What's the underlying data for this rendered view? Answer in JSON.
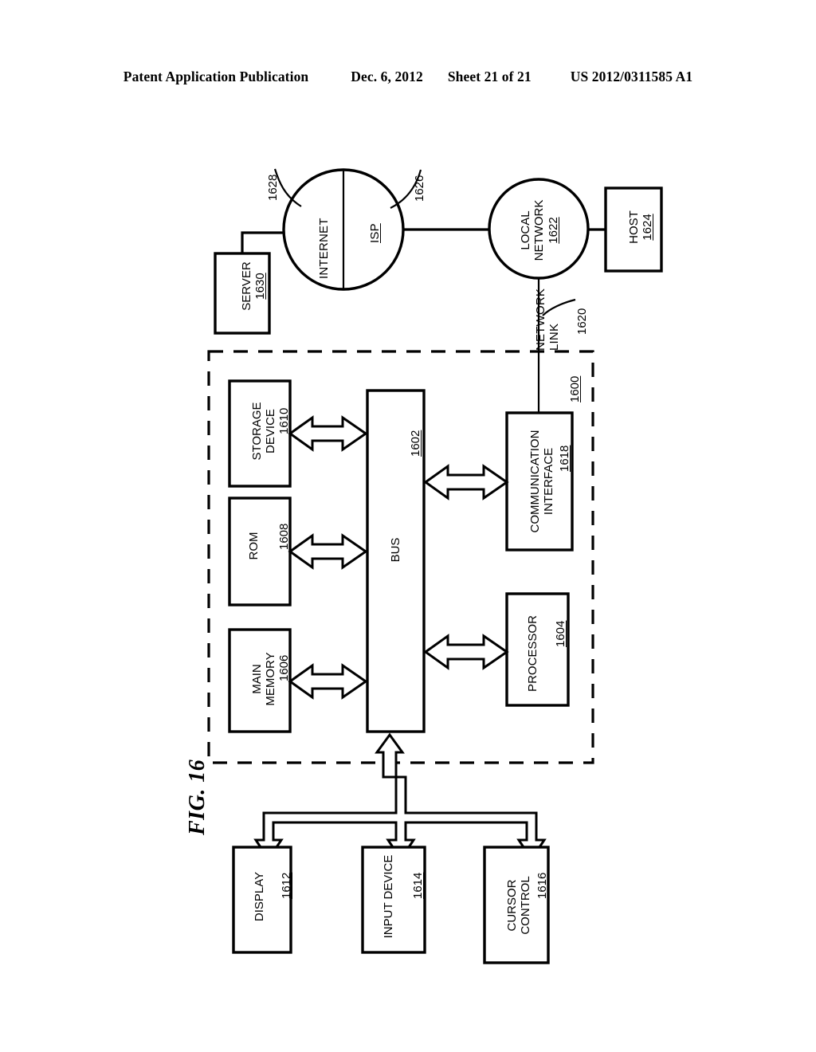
{
  "header": {
    "publication": "Patent Application Publication",
    "date": "Dec. 6, 2012",
    "sheet": "Sheet 21 of 21",
    "patent_number": "US 2012/0311585 A1"
  },
  "figure": {
    "caption": "FIG. 16",
    "system_ref": "1600",
    "nodes": {
      "internet": {
        "label": "INTERNET",
        "ref": "1628"
      },
      "isp": {
        "label": "ISP",
        "ref": "1626"
      },
      "server": {
        "label": "SERVER",
        "ref": "1630"
      },
      "local_network": {
        "label_line1": "LOCAL",
        "label_line2": "NETWORK",
        "ref": "1622"
      },
      "host": {
        "label": "HOST",
        "ref": "1624"
      },
      "network_link": {
        "label_line1": "NETWORK",
        "label_line2": "LINK",
        "ref": "1620"
      },
      "storage_device": {
        "label_line1": "STORAGE",
        "label_line2": "DEVICE",
        "ref": "1610"
      },
      "rom": {
        "label": "ROM",
        "ref": "1608"
      },
      "main_memory": {
        "label_line1": "MAIN",
        "label_line2": "MEMORY",
        "ref": "1606"
      },
      "bus": {
        "label": "BUS",
        "ref": "1602"
      },
      "communication_interface": {
        "label_line1": "COMMUNICATION",
        "label_line2": "INTERFACE",
        "ref": "1618"
      },
      "processor": {
        "label": "PROCESSOR",
        "ref": "1604"
      },
      "display": {
        "label": "DISPLAY",
        "ref": "1612"
      },
      "input_device": {
        "label": "INPUT DEVICE",
        "ref": "1614"
      },
      "cursor_control": {
        "label_line1": "CURSOR",
        "label_line2": "CONTROL",
        "ref": "1616"
      }
    },
    "colors": {
      "stroke": "#000000",
      "fill": "#ffffff",
      "background": "#ffffff"
    }
  }
}
